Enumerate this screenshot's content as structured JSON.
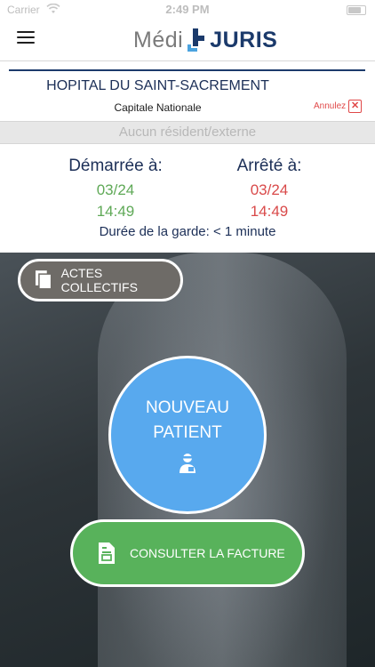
{
  "status_bar": {
    "carrier": "Carrier",
    "time": "2:49 PM"
  },
  "header": {
    "logo_left": "Médi",
    "logo_right": "JURIS"
  },
  "hospital": {
    "name": "HOPITAL DU SAINT-SACREMENT",
    "region": "Capitale Nationale",
    "cancel_label": "Annulez",
    "resident_placeholder": "Aucun résident/externe"
  },
  "timing": {
    "start_label": "Démarrée à:",
    "start_date": "03/24",
    "start_time": "14:49",
    "stop_label": "Arrêté à:",
    "stop_date": "03/24",
    "stop_time": "14:49",
    "duration": "Durée de la garde: < 1 minute"
  },
  "actions": {
    "collective_label": "ACTES COLLECTIFS",
    "new_patient_label": "NOUVEAU PATIENT",
    "invoice_label": "CONSULTER LA FACTURE"
  },
  "colors": {
    "navy": "#1c3b6c",
    "start_green": "#5fa957",
    "stop_red": "#d94a4a",
    "patient_blue": "#58a9ee",
    "invoice_green": "#58b25b"
  },
  "icons": {
    "menu": "hamburger-icon",
    "collective": "documents-icon",
    "patient": "patient-icon",
    "invoice": "invoice-icon",
    "cancel": "close-icon"
  }
}
